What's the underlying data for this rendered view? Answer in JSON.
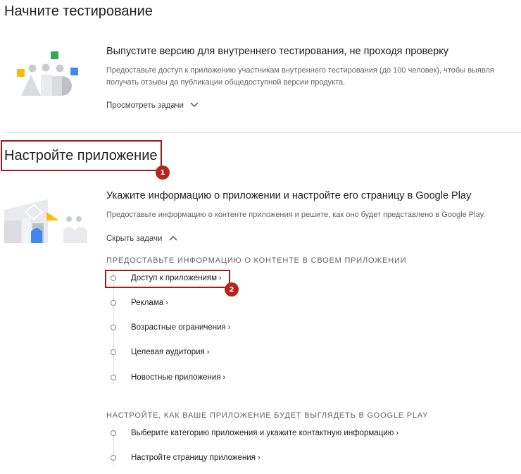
{
  "testing": {
    "title": "Начните тестирование",
    "heading": "Выпустите версию для внутреннего тестирования, не проходя проверку",
    "description": "Предоставьте доступ к приложению участникам внутреннего тестирования (до 100 человек), чтобы выявля получать отзывы до публикации общедоступной версии продукта.",
    "toggle_label": "Просмотреть задачи"
  },
  "setup": {
    "title": "Настройте приложение",
    "heading": "Укажите информацию о приложении и настройте его страницу в Google Play",
    "description": "Предоставьте информацию о контенте приложения и решите, как оно будет представлено в Google Play.",
    "toggle_label": "Скрыть задачи",
    "group1": {
      "header": "ПРЕДОСТАВЬТЕ ИНФОРМАЦИЮ О КОНТЕНТЕ В СВОЕМ ПРИЛОЖЕНИИ",
      "tasks": [
        "Доступ к приложениям",
        "Реклама",
        "Возрастные ограничения",
        "Целевая аудитория",
        "Новостные приложения"
      ]
    },
    "group2": {
      "header": "НАСТРОЙТЕ, КАК ВАШЕ ПРИЛОЖЕНИЕ БУДЕТ ВЫГЛЯДЕТЬ В GOOGLE PLAY",
      "tasks": [
        "Выберите категорию приложения и укажите контактную информацию",
        "Настройте страницу приложения"
      ]
    }
  },
  "annotations": {
    "badge1": "1",
    "badge2": "2"
  },
  "colors": {
    "highlight": "#9b1c1c",
    "badge": "#b3261e",
    "green": "#34a853",
    "yellow": "#fbbc04",
    "blue": "#4285f4"
  }
}
